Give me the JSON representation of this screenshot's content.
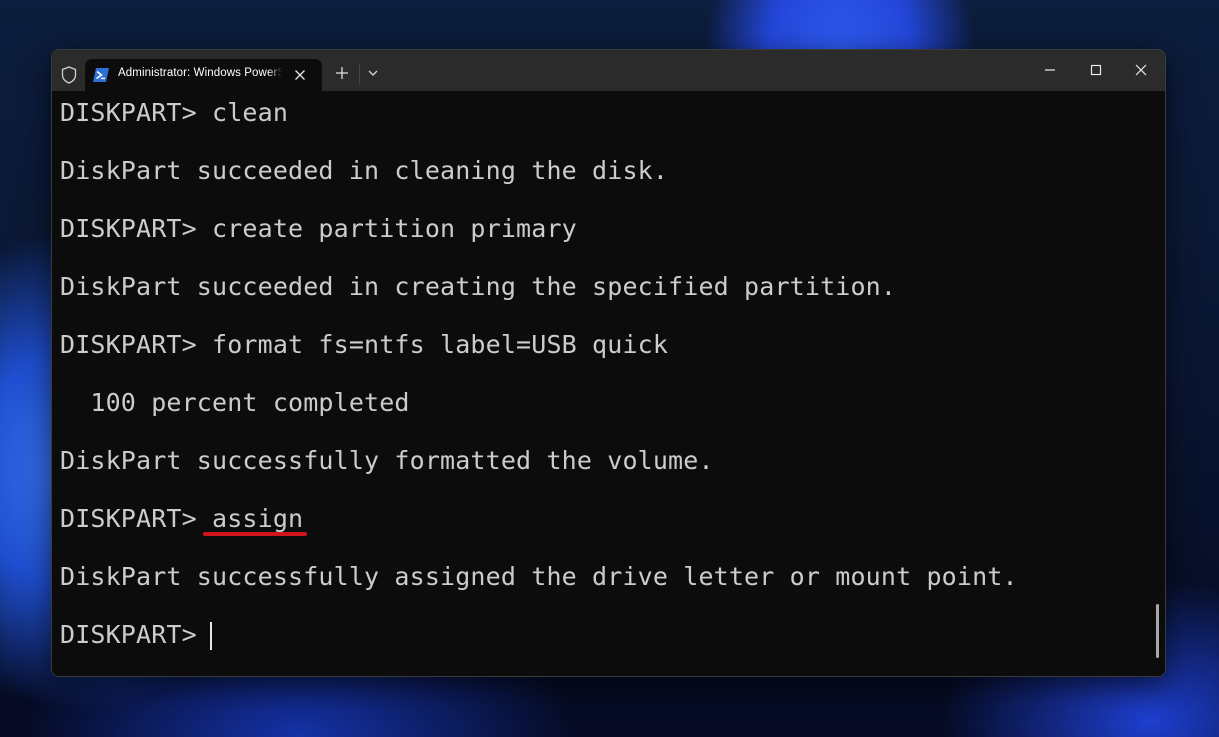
{
  "window": {
    "tab_title": "Administrator: Windows PowerShell",
    "icons": {
      "shield": "shield-icon",
      "tab": "powershell-icon",
      "tab_close": "close-icon",
      "new_tab": "plus-icon",
      "dropdown": "chevron-down-icon",
      "minimize": "minimize-icon",
      "maximize": "maximize-icon",
      "close": "close-icon"
    }
  },
  "console": {
    "lines": [
      "DISKPART> clean",
      "DiskPart succeeded in cleaning the disk.",
      "DISKPART> create partition primary",
      "DiskPart succeeded in creating the specified partition.",
      "DISKPART> format fs=ntfs label=USB quick",
      "  100 percent completed",
      "DiskPart successfully formatted the volume.",
      "DISKPART> assign",
      "DiskPart successfully assigned the drive letter or mount point.",
      "DISKPART> "
    ],
    "highlighted_command": "assign",
    "highlight_color": "#d0161b"
  },
  "colors": {
    "terminal_bg": "#0c0c0c",
    "titlebar_bg": "#2b2b2b",
    "text": "#cccccc"
  }
}
